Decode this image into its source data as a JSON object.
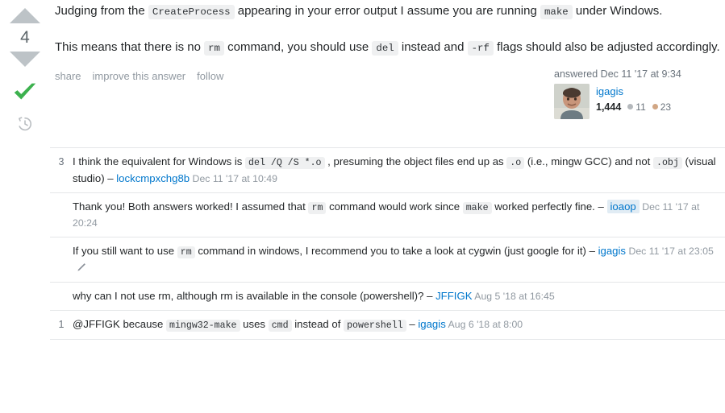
{
  "vote": {
    "up_icon": "arrow-up-icon",
    "down_icon": "arrow-down-icon",
    "count": "4",
    "accepted_icon": "checkmark-icon",
    "history_icon": "history-clock-icon"
  },
  "answer": {
    "paragraph1": {
      "part1": "Judging from the ",
      "code1": "CreateProcess",
      "part2": " appearing in your error output I assume you are running ",
      "code2": "make",
      "part3": " under Windows."
    },
    "paragraph2": {
      "part1": "This means that there is no ",
      "code1": "rm",
      "part2": " command, you should use ",
      "code2": "del",
      "part3": " instead and ",
      "code3": "-rf",
      "part4": " flags should also be adjusted accordingly."
    }
  },
  "post_menu": {
    "share": "share",
    "improve": "improve this answer",
    "follow": "follow"
  },
  "signature": {
    "action_time": "answered Dec 11 '17 at 9:34",
    "user_name": "igagis",
    "reputation": "1,444",
    "silver_count": "11",
    "bronze_count": "23",
    "avatar_icon": "user-avatar-photo"
  },
  "comments": [
    {
      "score": "3",
      "segments": [
        {
          "type": "text",
          "value": "I think the equivalent for Windows is "
        },
        {
          "type": "code",
          "value": "del /Q /S *.o"
        },
        {
          "type": "text",
          "value": " , presuming the object files end up as "
        },
        {
          "type": "code",
          "value": ".o"
        },
        {
          "type": "text",
          "value": " (i.e., mingw GCC) and not "
        },
        {
          "type": "code",
          "value": ".obj"
        },
        {
          "type": "text",
          "value": " (visual studio) "
        }
      ],
      "dash": "–",
      "user": "lockcmpxchg8b",
      "op": false,
      "date": "Dec 11 '17 at 10:49",
      "edited": false
    },
    {
      "score": "",
      "segments": [
        {
          "type": "text",
          "value": "Thank you! Both answers worked! I assumed that "
        },
        {
          "type": "code",
          "value": "rm"
        },
        {
          "type": "text",
          "value": " command would work since "
        },
        {
          "type": "code",
          "value": "make"
        },
        {
          "type": "text",
          "value": " worked perfectly fine. "
        }
      ],
      "dash": "–",
      "user": "ioaop",
      "op": true,
      "date": "Dec 11 '17 at 20:24",
      "edited": false
    },
    {
      "score": "",
      "segments": [
        {
          "type": "text",
          "value": "If you still want to use "
        },
        {
          "type": "code",
          "value": "rm"
        },
        {
          "type": "text",
          "value": " command in windows, I recommend you to take a look at cygwin (just google for it) "
        }
      ],
      "dash": "–",
      "user": "igagis",
      "op": false,
      "date": "Dec 11 '17 at 23:05",
      "edited": true
    },
    {
      "score": "",
      "segments": [
        {
          "type": "text",
          "value": "why can I not use rm, although rm is available in the console (powershell)? "
        }
      ],
      "dash": "–",
      "user": "JFFIGK",
      "op": false,
      "date": "Aug 5 '18 at 16:45",
      "edited": false
    },
    {
      "score": "1",
      "segments": [
        {
          "type": "text",
          "value": "@JFFIGK because "
        },
        {
          "type": "code",
          "value": "mingw32-make"
        },
        {
          "type": "text",
          "value": " uses "
        },
        {
          "type": "code",
          "value": "cmd"
        },
        {
          "type": "text",
          "value": " instead of "
        },
        {
          "type": "code",
          "value": "powershell"
        },
        {
          "type": "text",
          "value": " "
        }
      ],
      "dash": "–",
      "user": "igagis",
      "op": false,
      "date": "Aug 6 '18 at 8:00",
      "edited": false
    }
  ],
  "colors": {
    "link": "#0077cc",
    "accepted_green": "#3cb14e",
    "arrow_gray": "#bdc3c7",
    "code_bg": "#eff0f1",
    "muted": "#9199a1",
    "op_highlight": "#e1ecf4"
  }
}
